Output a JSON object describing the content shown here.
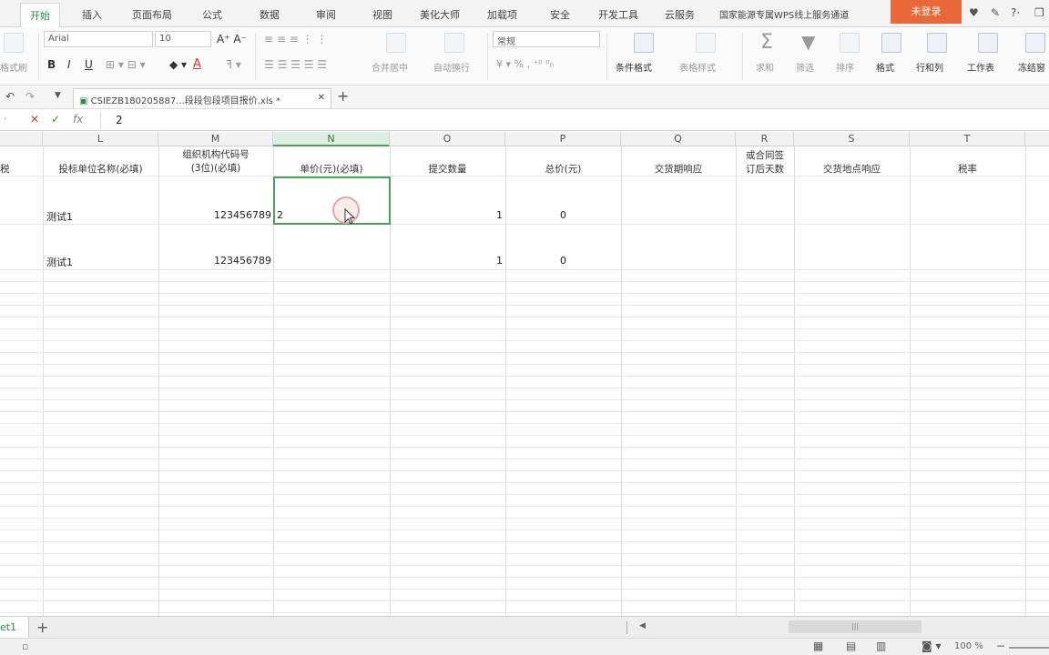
{
  "menu": {
    "tabs": [
      "开始",
      "插入",
      "页面布局",
      "公式",
      "数据",
      "审阅",
      "视图",
      "美化大师",
      "加载项",
      "安全",
      "开发工具",
      "云服务",
      "国家能源专属WPS线上服务通道"
    ],
    "login_label": "未登录"
  },
  "ribbon": {
    "format_painter": "格式刷",
    "font_name": "Arial",
    "font_size": "10",
    "number_format": "常规",
    "merge_center": "合并居中",
    "wrap_text": "自动换行",
    "conditional_format": "条件格式",
    "table_style": "表格样式",
    "sum": "求和",
    "filter": "筛选",
    "sort": "排序",
    "format": "格式",
    "row_col": "行和列",
    "worksheet": "工作表",
    "freeze": "冻结窗"
  },
  "doc_tab": {
    "title": "CSIEZB180205887...段段包段项目报价.xls *"
  },
  "formula_bar": {
    "cancel": "✕",
    "confirm": "✓",
    "fx": "fx",
    "value": "2"
  },
  "columns": [
    {
      "letter": "L"
    },
    {
      "letter": "M"
    },
    {
      "letter": "N"
    },
    {
      "letter": "O"
    },
    {
      "letter": "P"
    },
    {
      "letter": "Q"
    },
    {
      "letter": "R"
    },
    {
      "letter": "S"
    },
    {
      "letter": "T"
    }
  ],
  "header_row": {
    "K": "税",
    "L": "投标单位名称(必填)",
    "M1": "组织机构代码号",
    "M2": "(3位)(必填)",
    "N": "单价(元)(必填)",
    "O": "提交数量",
    "P": "总价(元)",
    "Q": "交货期响应",
    "R1": "或合同签",
    "R2": "订后天数",
    "S": "交货地点响应",
    "T": "税率"
  },
  "rows": [
    {
      "L": "测试1",
      "M": "123456789",
      "N": "2",
      "O": "1",
      "P": "0"
    },
    {
      "L": "测试1",
      "M": "123456789",
      "N": "",
      "O": "1",
      "P": "0"
    }
  ],
  "sheet_tab": "et1",
  "status": {
    "zoom": "100 %"
  },
  "colors": {
    "accent_green": "#4aa058",
    "login_orange": "#e8683a"
  }
}
